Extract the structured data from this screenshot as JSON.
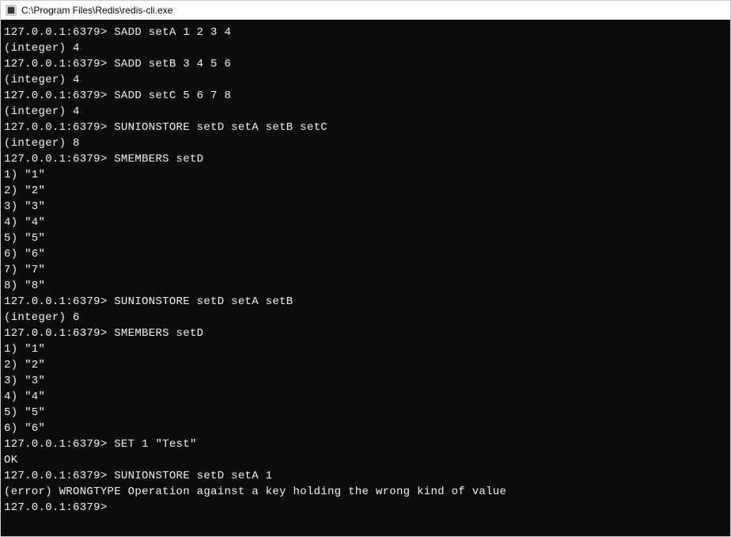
{
  "window": {
    "title": "C:\\Program Files\\Redis\\redis-cli.exe"
  },
  "prompt": "127.0.0.1:6379>",
  "session": {
    "lines": [
      {
        "type": "cmd",
        "prompt": "127.0.0.1:6379>",
        "text": " SADD setA 1 2 3 4"
      },
      {
        "type": "out",
        "text": "(integer) 4"
      },
      {
        "type": "cmd",
        "prompt": "127.0.0.1:6379>",
        "text": " SADD setB 3 4 5 6"
      },
      {
        "type": "out",
        "text": "(integer) 4"
      },
      {
        "type": "cmd",
        "prompt": "127.0.0.1:6379>",
        "text": " SADD setC 5 6 7 8"
      },
      {
        "type": "out",
        "text": "(integer) 4"
      },
      {
        "type": "cmd",
        "prompt": "127.0.0.1:6379>",
        "text": " SUNIONSTORE setD setA setB setC"
      },
      {
        "type": "out",
        "text": "(integer) 8"
      },
      {
        "type": "cmd",
        "prompt": "127.0.0.1:6379>",
        "text": " SMEMBERS setD"
      },
      {
        "type": "out",
        "text": "1) \"1\""
      },
      {
        "type": "out",
        "text": "2) \"2\""
      },
      {
        "type": "out",
        "text": "3) \"3\""
      },
      {
        "type": "out",
        "text": "4) \"4\""
      },
      {
        "type": "out",
        "text": "5) \"5\""
      },
      {
        "type": "out",
        "text": "6) \"6\""
      },
      {
        "type": "out",
        "text": "7) \"7\""
      },
      {
        "type": "out",
        "text": "8) \"8\""
      },
      {
        "type": "cmd",
        "prompt": "127.0.0.1:6379>",
        "text": " SUNIONSTORE setD setA setB"
      },
      {
        "type": "out",
        "text": "(integer) 6"
      },
      {
        "type": "cmd",
        "prompt": "127.0.0.1:6379>",
        "text": " SMEMBERS setD"
      },
      {
        "type": "out",
        "text": "1) \"1\""
      },
      {
        "type": "out",
        "text": "2) \"2\""
      },
      {
        "type": "out",
        "text": "3) \"3\""
      },
      {
        "type": "out",
        "text": "4) \"4\""
      },
      {
        "type": "out",
        "text": "5) \"5\""
      },
      {
        "type": "out",
        "text": "6) \"6\""
      },
      {
        "type": "cmd",
        "prompt": "127.0.0.1:6379>",
        "text": " SET 1 \"Test\""
      },
      {
        "type": "out",
        "text": "OK"
      },
      {
        "type": "cmd",
        "prompt": "127.0.0.1:6379>",
        "text": " SUNIONSTORE setD setA 1"
      },
      {
        "type": "out",
        "text": "(error) WRONGTYPE Operation against a key holding the wrong kind of value"
      },
      {
        "type": "cmd",
        "prompt": "127.0.0.1:6379>",
        "text": ""
      }
    ]
  }
}
